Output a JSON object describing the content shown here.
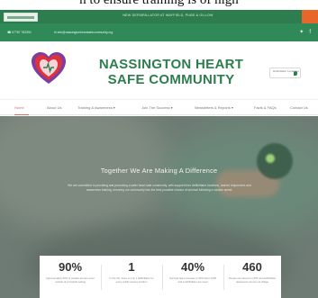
{
  "caption": "h to ensure training is of high",
  "topbar": {
    "ticker": "NEW DEFIBRILLATOR AT WAYFIELD, PUBS & GILLOW",
    "flag_icon": "flag-icon",
    "colors": {
      "bar": "#2e7d4f",
      "cta": "#e7672b"
    }
  },
  "contact": {
    "phone": "07787 782391",
    "email": "info@nassingtonheartsafecommunity.org",
    "social_icons": [
      "twitter-icon",
      "facebook-icon"
    ]
  },
  "header": {
    "title": "NASSINGTON HEART SAFE COMMUNITY",
    "badge_text": "Defibrillator Locations",
    "logo_icon": "heart-logo-icon",
    "colors": {
      "title": "#2e7d4f",
      "heart_red": "#e0323a",
      "heart_purple": "#7b3fa0"
    }
  },
  "nav": {
    "items": [
      {
        "label": "Home",
        "active": true
      },
      {
        "label": "About Us",
        "active": false
      },
      {
        "label": "Training & Awareness ▾",
        "active": false
      },
      {
        "label": "Join The Success ▾",
        "active": false
      },
      {
        "label": "Newsletters & Reports ▾",
        "active": false
      },
      {
        "label": "Facts & FAQs",
        "active": false
      },
      {
        "label": "Contact Us",
        "active": false
      }
    ]
  },
  "hero": {
    "title": "Together We Are Making A Difference",
    "text": "We are committed to providing and promoting a safer heart safe community, with support from defibrillator locations, trained responders and awareness training, ensuring our community has the best possible chance of survival following a cardiac arrest."
  },
  "stats": [
    {
      "value": "90%",
      "desc": "Approximately 90% of cardiac arrests occur outside of a hospital setting"
    },
    {
      "value": "1",
      "desc": "In the UK, there is only 1 defibrillator for every public access location"
    },
    {
      "value": "40%",
      "desc": "Survival rates increase to 40% when CPR and a defibrillator are used"
    },
    {
      "value": "460",
      "desc": "People are trained in CPR and defibrillator awareness across our village"
    }
  ]
}
